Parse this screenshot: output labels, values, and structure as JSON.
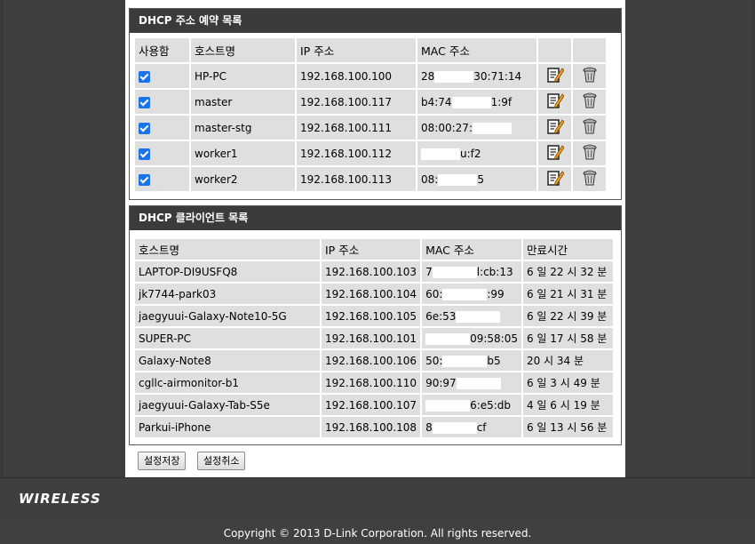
{
  "reservation": {
    "title": "DHCP 주소 예약 목록",
    "headers": {
      "enable": "사용함",
      "host": "호스트명",
      "ip": "IP 주소",
      "mac": "MAC 주소"
    },
    "rows": [
      {
        "host": "HP-PC",
        "ip": "192.168.100.100",
        "mac_a": "28",
        "mac_b": "30:71:14"
      },
      {
        "host": "master",
        "ip": "192.168.100.117",
        "mac_a": "b4:74",
        "mac_b": "1:9f"
      },
      {
        "host": "master-stg",
        "ip": "192.168.100.111",
        "mac_a": "08:00:27:",
        "mac_b": ""
      },
      {
        "host": "worker1",
        "ip": "192.168.100.112",
        "mac_a": "",
        "mac_b": "u:f2"
      },
      {
        "host": "worker2",
        "ip": "192.168.100.113",
        "mac_a": "08:",
        "mac_b": "5"
      }
    ]
  },
  "clients": {
    "title": "DHCP 클라이언트 목록",
    "headers": {
      "host": "호스트명",
      "ip": "IP 주소",
      "mac": "MAC 주소",
      "expire": "만료시간"
    },
    "rows": [
      {
        "host": "LAPTOP-DI9USFQ8",
        "ip": "192.168.100.103",
        "mac_a": "7",
        "mac_b": "l:cb:13",
        "expire": "6 일 22 시 32 분"
      },
      {
        "host": "jk7744-park03",
        "ip": "192.168.100.104",
        "mac_a": "60:",
        "mac_b": ":99",
        "expire": "6 일 21 시 31 분"
      },
      {
        "host": "jaegyuui-Galaxy-Note10-5G",
        "ip": "192.168.100.105",
        "mac_a": "6e:53",
        "mac_b": "",
        "expire": "6 일 22 시 39 분"
      },
      {
        "host": "SUPER-PC",
        "ip": "192.168.100.101",
        "mac_a": "",
        "mac_b": "09:58:05",
        "expire": "6 일 17 시 58 분"
      },
      {
        "host": "Galaxy-Note8",
        "ip": "192.168.100.106",
        "mac_a": "50:",
        "mac_b": "b5",
        "expire": "20 시 34 분"
      },
      {
        "host": "cgllc-airmonitor-b1",
        "ip": "192.168.100.110",
        "mac_a": "90:97",
        "mac_b": "",
        "expire": "6 일 3 시 49 분"
      },
      {
        "host": "jaegyuui-Galaxy-Tab-S5e",
        "ip": "192.168.100.107",
        "mac_a": "",
        "mac_b": "6:e5:db",
        "expire": "4 일 6 시 19 분"
      },
      {
        "host": "Parkui-iPhone",
        "ip": "192.168.100.108",
        "mac_a": "8",
        "mac_b": "cf",
        "expire": "6 일 13 시 56 분"
      }
    ]
  },
  "buttons": {
    "save": "설정저장",
    "cancel": "설정취소"
  },
  "brand": {
    "wireless": "WIRELESS"
  },
  "footer": {
    "copyright": "Copyright © 2013 D-Link Corporation. All rights reserved."
  },
  "icons": {
    "edit": "edit-icon",
    "delete": "trash-icon"
  },
  "colors": {
    "section_header": "#3b3b3b",
    "cell_bg": "#dfdfdf",
    "checkbox": "#1a73e8"
  }
}
